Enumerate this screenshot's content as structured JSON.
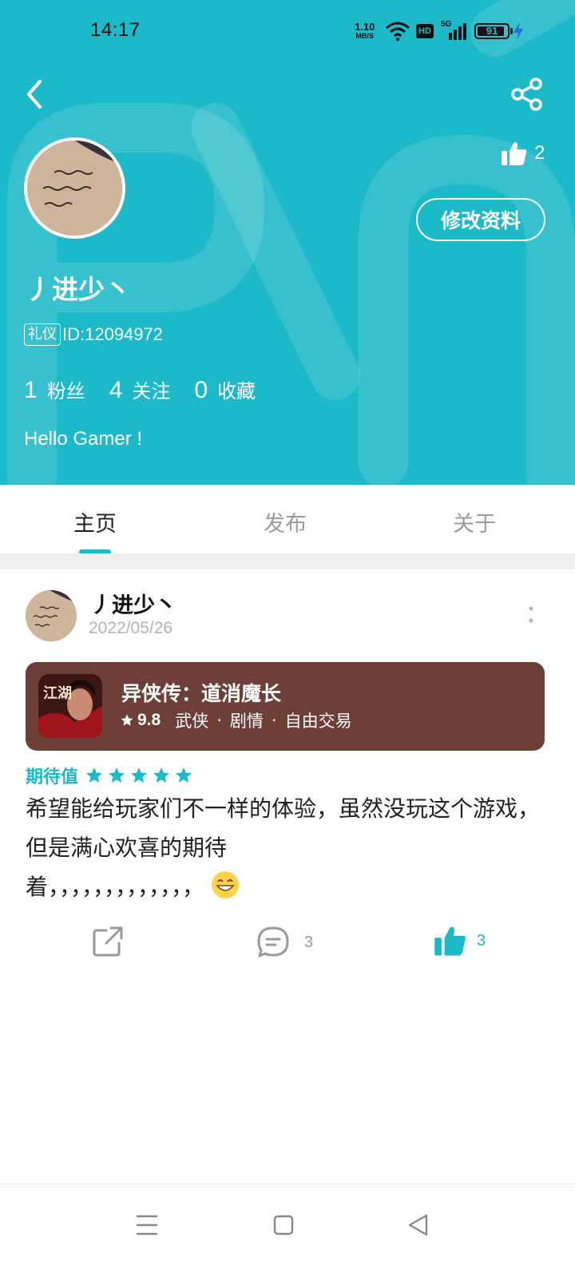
{
  "status_bar": {
    "time": "14:17",
    "net_speed_value": "1.10",
    "net_speed_unit": "MB/S",
    "hd_label": "HD",
    "signal_label": "5G",
    "battery_level": "91",
    "battery_fraction": 0.91
  },
  "profile": {
    "username": "丿进少丶",
    "badge": "礼仪",
    "id_text": "ID:12094972",
    "likes": "2",
    "edit_button": "修改资料",
    "stats": [
      {
        "num": "1",
        "label": "粉丝"
      },
      {
        "num": "4",
        "label": "关注"
      },
      {
        "num": "0",
        "label": "收藏"
      }
    ],
    "bio": "Hello Gamer !"
  },
  "tabs": [
    {
      "label": "主页",
      "active": true
    },
    {
      "label": "发布",
      "active": false
    },
    {
      "label": "关于",
      "active": false
    }
  ],
  "post": {
    "author": "丿进少丶",
    "date": "2022/05/26",
    "game": {
      "title": "异侠传：道消魔长",
      "score": "9.8",
      "tags": [
        "武侠",
        "剧情",
        "自由交易"
      ],
      "tag_separator": "·",
      "icon_text": "江湖"
    },
    "expect_label": "期待值",
    "expect_stars": 5,
    "review_line1": "希望能给玩家们不一样的体验，虽然没玩这个游戏，但是满心欢喜的期待",
    "review_line2": "着，，，，，，，，，，，，，",
    "comment_count": "3",
    "like_count": "3"
  },
  "colors": {
    "accent": "#1cb9c8",
    "game_card_bg": "#6e3f36"
  },
  "icons": [
    "back-icon",
    "share-icon",
    "thumbs-up-icon",
    "more-vertical-icon",
    "star-icon",
    "external-share-icon",
    "comment-icon",
    "grin-emoji-icon",
    "menu-icon",
    "home-square-icon",
    "back-triangle-icon"
  ]
}
